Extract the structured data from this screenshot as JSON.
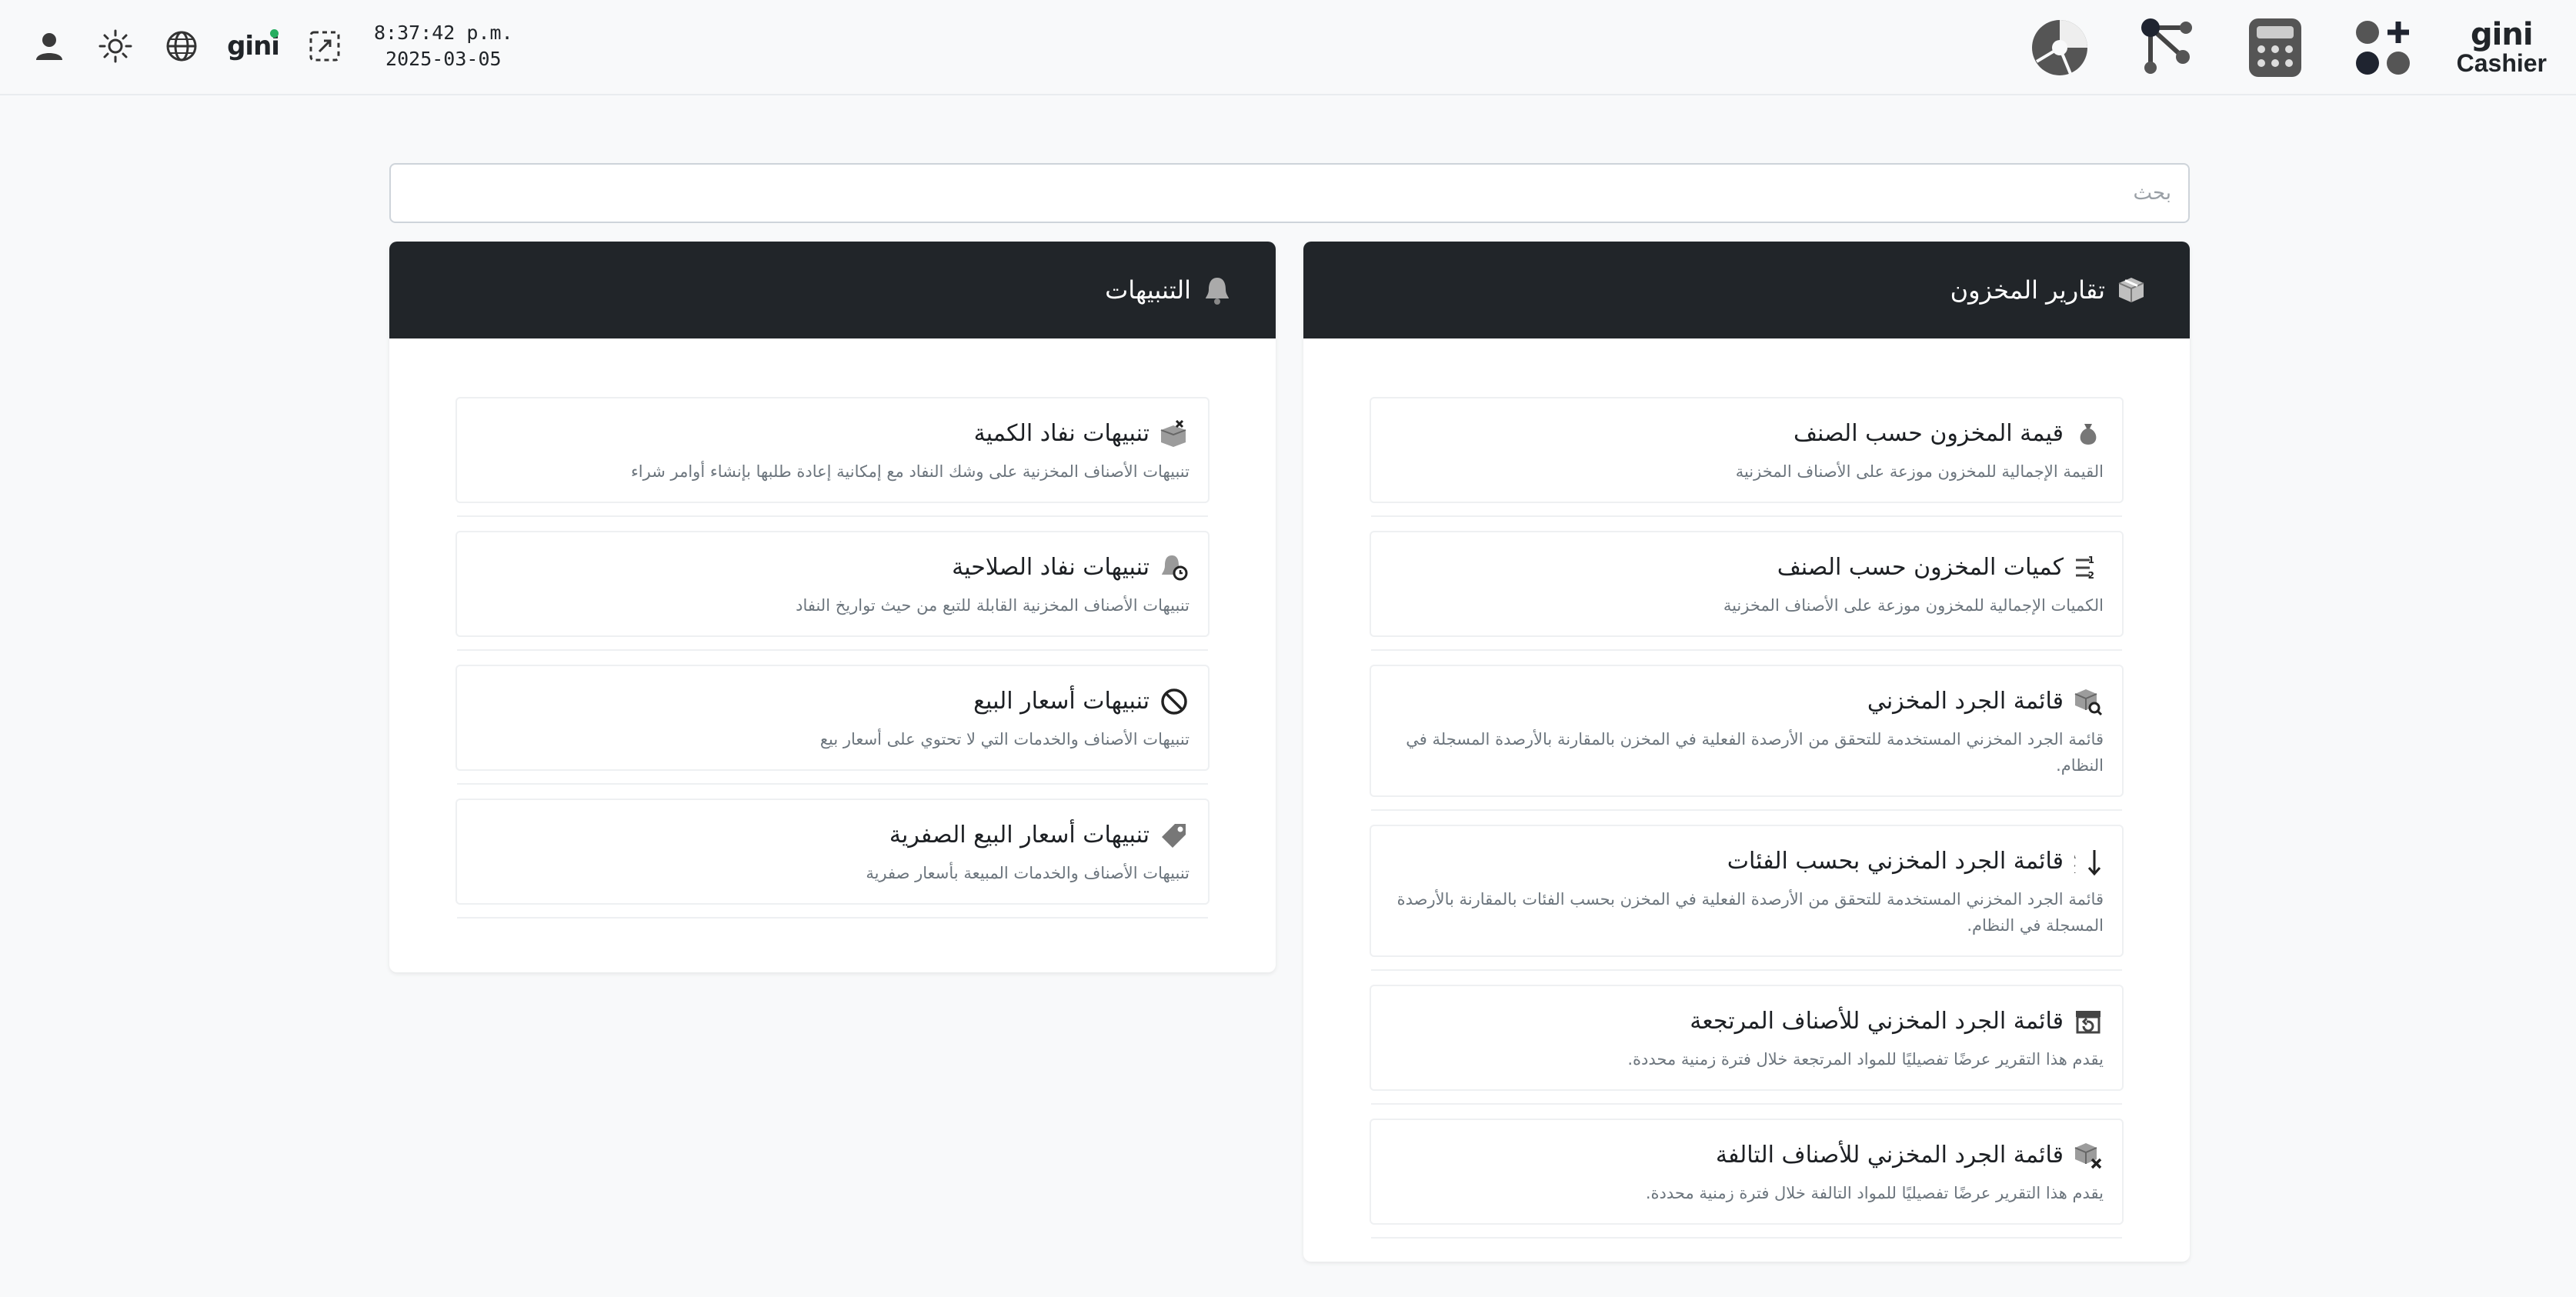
{
  "header": {
    "time": "8:37:42 p.m.",
    "date": "2025-03-05",
    "brand_small": "gini",
    "brand_logo": "gini",
    "brand_sub": "Cashier",
    "icons_left": [
      "user-icon",
      "sun-icon",
      "globe-icon",
      "gini-logo-icon",
      "fullscreen-icon"
    ],
    "icons_right": [
      "pie-chart-icon",
      "network-icon",
      "calculator-icon",
      "apps-add-icon"
    ]
  },
  "search": {
    "placeholder": "بحث"
  },
  "inventory_reports": {
    "title": "تقارير المخزون",
    "icon": "box-icon",
    "items": [
      {
        "title": "قيمة المخزون حسب الصنف",
        "desc": "القيمة الإجمالية للمخزون موزعة على الأصناف المخزنية",
        "icon": "money-bag-icon"
      },
      {
        "title": "كميات المخزون حسب الصنف",
        "desc": "الكميات الإجمالية للمخزون موزعة على الأصناف المخزنية",
        "icon": "numbered-list-icon"
      },
      {
        "title": "قائمة الجرد المخزني",
        "desc": "قائمة الجرد المخزني المستخدمة للتحقق من الأرصدة الفعلية في المخزن بالمقارنة بالأرصدة المسجلة في النظام.",
        "icon": "box-search-icon"
      },
      {
        "title": "قائمة الجرد المخزني بحسب الفئات",
        "desc": "قائمة الجرد المخزني المستخدمة للتحقق من الأرصدة الفعلية في المخزن بحسب الفئات بالمقارنة بالأرصدة المسجلة في النظام.",
        "icon": "sort-alpha-icon"
      },
      {
        "title": "قائمة الجرد المخزني للأصناف المرتجعة",
        "desc": "يقدم هذا التقرير عرضًا تفصيليًا للمواد المرتجعة خلال فترة زمنية محددة.",
        "icon": "box-return-icon"
      },
      {
        "title": "قائمة الجرد المخزني للأصناف التالفة",
        "desc": "يقدم هذا التقرير عرضًا تفصيليًا للمواد التالفة خلال فترة زمنية محددة.",
        "icon": "box-damaged-icon"
      }
    ]
  },
  "alerts": {
    "title": "التنبيهات",
    "icon": "bell-icon",
    "items": [
      {
        "title": "تنبيهات نفاد الكمية",
        "desc": "تنبيهات الأصناف المخزنية على وشك النفاد مع إمكانية إعادة طلبها بإنشاء أوامر شراء",
        "icon": "box-alert-icon"
      },
      {
        "title": "تنبيهات نفاد الصلاحية",
        "desc": "تنبيهات الأصناف المخزنية القابلة للتبع من حيث تواريخ النفاد",
        "icon": "bell-clock-icon"
      },
      {
        "title": "تنبيهات أسعار البيع",
        "desc": "تنبيهات الأصناف والخدمات التي لا تحتوي على أسعار بيع",
        "icon": "ban-icon"
      },
      {
        "title": "تنبيهات أسعار البيع الصفرية",
        "desc": "تنبيهات الأصناف والخدمات المبيعة بأسعار صفرية",
        "icon": "tag-icon"
      }
    ]
  },
  "colors": {
    "header_bg": "#212529",
    "page_bg": "#f8f9fa",
    "accent_dot": "#27ae60"
  }
}
